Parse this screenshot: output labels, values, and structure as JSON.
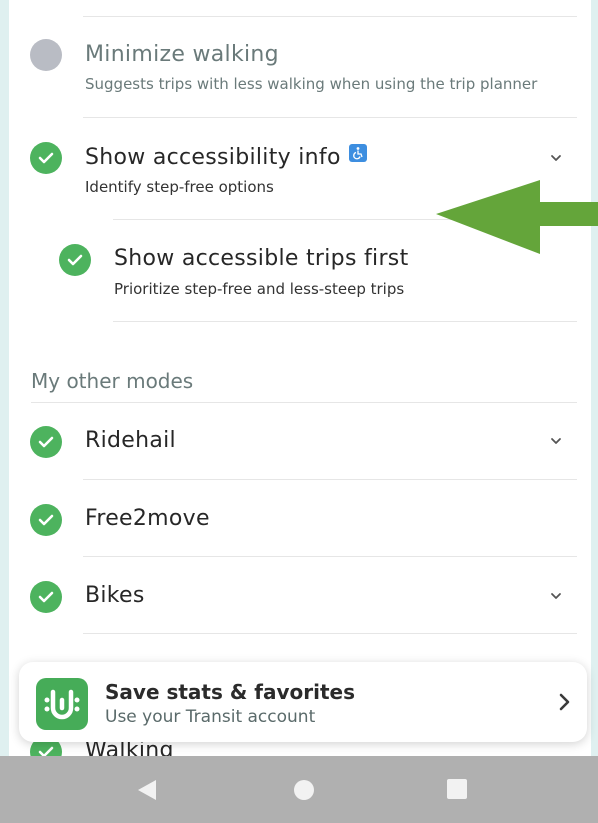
{
  "settings": {
    "minimize_walking": {
      "title": "Minimize walking",
      "subtitle": "Suggests trips with less walking when using the trip planner",
      "enabled": false
    },
    "accessibility": {
      "title": "Show accessibility info",
      "subtitle": "Identify step-free options",
      "enabled": true,
      "icon": "wheelchair-icon"
    },
    "accessible_trips": {
      "title": "Show accessible trips first",
      "subtitle": "Prioritize step-free and less-steep trips",
      "enabled": true
    }
  },
  "other_modes": {
    "header": "My other modes",
    "items": [
      {
        "label": "Ridehail",
        "enabled": true,
        "expandable": true
      },
      {
        "label": "Free2move",
        "enabled": true,
        "expandable": false
      },
      {
        "label": "Bikes",
        "enabled": true,
        "expandable": true
      },
      {
        "label": "Walking",
        "enabled": true,
        "expandable": false
      }
    ]
  },
  "toast": {
    "title": "Save stats & favorites",
    "subtitle": "Use your Transit account",
    "icon": "transit-logo-icon"
  },
  "annotation": {
    "icon": "green-arrow-icon",
    "color": "#64a53a"
  },
  "navbar": {
    "back": "back-triangle-icon",
    "home": "home-circle-icon",
    "recents": "recents-square-icon"
  },
  "colors": {
    "check": "#4db35e",
    "check_off": "#b9bcc4",
    "badge": "#3d8ee0"
  }
}
